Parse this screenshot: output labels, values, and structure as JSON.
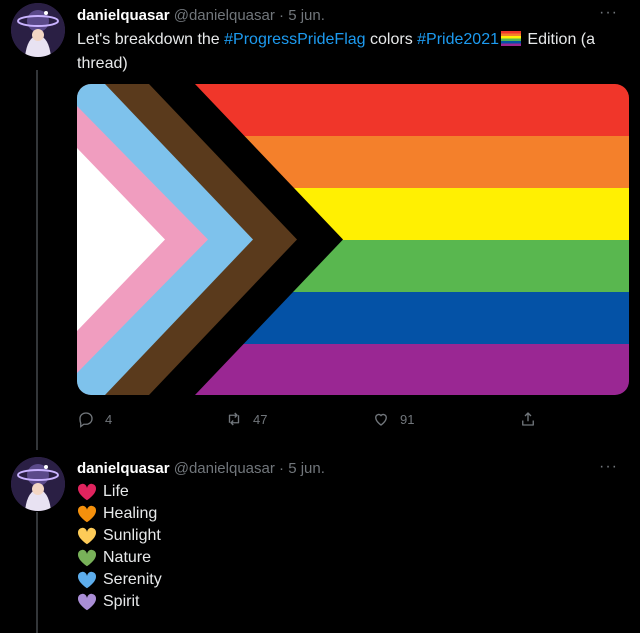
{
  "tweets": [
    {
      "name": "danielquasar",
      "handle": "@danielquasar",
      "separator": "·",
      "date": "5 jun.",
      "more": "···",
      "text_parts": [
        "Let's breakdown the ",
        "#ProgressPrideFlag",
        " colors ",
        "#Pride2021",
        " Edition (a thread)"
      ],
      "actions": {
        "reply_count": "4",
        "retweet_count": "47",
        "like_count": "91"
      }
    },
    {
      "name": "danielquasar",
      "handle": "@danielquasar",
      "separator": "·",
      "date": "5 jun.",
      "more": "···",
      "hearts": [
        {
          "label": "Life",
          "color": "#e0245e"
        },
        {
          "label": "Healing",
          "color": "#f4900c"
        },
        {
          "label": "Sunlight",
          "color": "#fdcb58"
        },
        {
          "label": "Nature",
          "color": "#78b159"
        },
        {
          "label": "Serenity",
          "color": "#5dadec"
        },
        {
          "label": "Spirit",
          "color": "#aa8ed6"
        }
      ]
    }
  ],
  "flag_colors": {
    "stripes": [
      "#f0362a",
      "#f4802b",
      "#fff002",
      "#59b74f",
      "#0452a6",
      "#9a2793"
    ],
    "chevrons": [
      "#000000",
      "#5a3a1c",
      "#7ec2ec",
      "#f09dbf",
      "#ffffff"
    ]
  },
  "colors": {
    "background": "#000000",
    "text": "#e7e9ea",
    "muted": "#71767b",
    "link": "#1d9bf0",
    "thread_line": "#333639"
  }
}
